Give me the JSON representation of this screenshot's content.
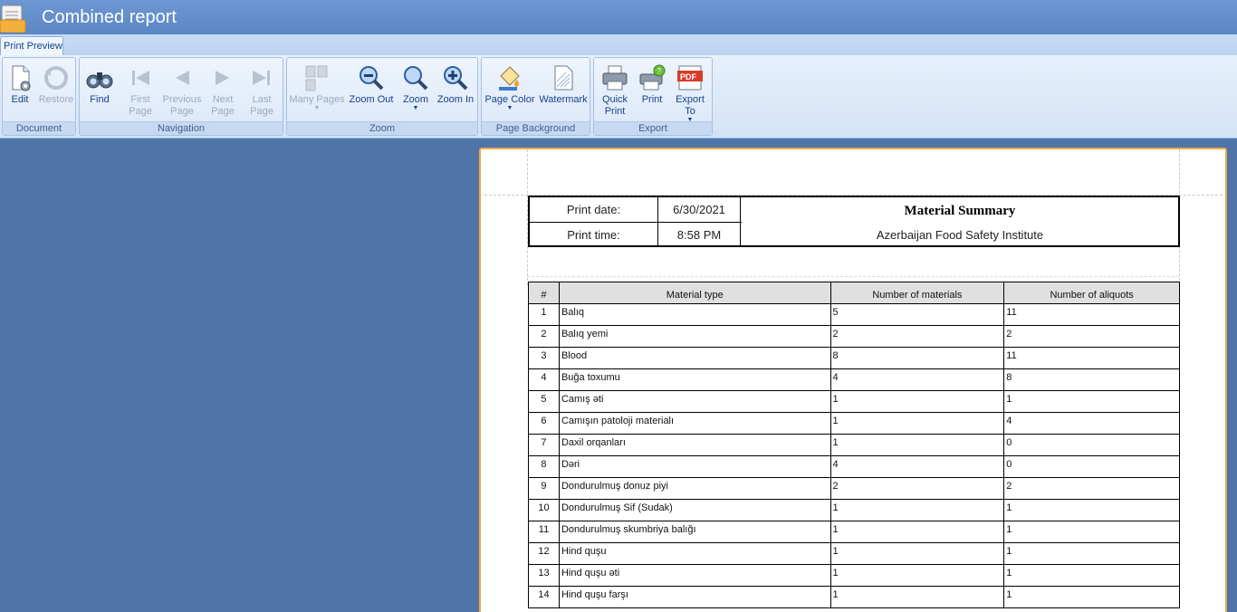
{
  "window": {
    "title": "Combined report"
  },
  "tabs": [
    {
      "label": "Print Preview"
    }
  ],
  "ribbon": {
    "groups": [
      {
        "label": "Document",
        "buttons": [
          {
            "label": "Edit",
            "enabled": true
          },
          {
            "label": "Restore",
            "enabled": false
          }
        ]
      },
      {
        "label": "Navigation",
        "buttons": [
          {
            "label": "Find",
            "enabled": true
          },
          {
            "label": "First Page",
            "enabled": false
          },
          {
            "label": "Previous Page",
            "enabled": false
          },
          {
            "label": "Next Page",
            "enabled": false
          },
          {
            "label": "Last Page",
            "enabled": false
          }
        ]
      },
      {
        "label": "Zoom",
        "buttons": [
          {
            "label": "Many Pages",
            "enabled": false
          },
          {
            "label": "Zoom Out",
            "enabled": true
          },
          {
            "label": "Zoom",
            "enabled": true
          },
          {
            "label": "Zoom In",
            "enabled": true
          }
        ]
      },
      {
        "label": "Page Background",
        "buttons": [
          {
            "label": "Page Color",
            "enabled": true
          },
          {
            "label": "Watermark",
            "enabled": true
          }
        ]
      },
      {
        "label": "Export",
        "buttons": [
          {
            "label": "Quick Print",
            "enabled": true
          },
          {
            "label": "Print",
            "enabled": true
          },
          {
            "label": "Export To",
            "enabled": true
          }
        ]
      }
    ]
  },
  "report": {
    "print_date_label": "Print date:",
    "print_date": "6/30/2021",
    "print_time_label": "Print time:",
    "print_time": "8:58 PM",
    "title": "Material Summary",
    "organization": "Azerbaijan Food Safety Institute",
    "columns": [
      "#",
      "Material type",
      "Number of materials",
      "Number of aliquots"
    ],
    "rows": [
      [
        "1",
        "Balıq",
        "5",
        "11"
      ],
      [
        "2",
        "Balıq yemi",
        "2",
        "2"
      ],
      [
        "3",
        "Blood",
        "8",
        "11"
      ],
      [
        "4",
        "Buğa toxumu",
        "4",
        "8"
      ],
      [
        "5",
        "Camış əti",
        "1",
        "1"
      ],
      [
        "6",
        "Camışın patoloji materialı",
        "1",
        "4"
      ],
      [
        "7",
        "Daxil orqanları",
        "1",
        "0"
      ],
      [
        "8",
        "Dəri",
        "4",
        "0"
      ],
      [
        "9",
        "Dondurulmuş donuz piyi",
        "2",
        "2"
      ],
      [
        "10",
        "Dondurulmuş Sif (Sudak)",
        "1",
        "1"
      ],
      [
        "11",
        "Dondurulmuş skumbriya balığı",
        "1",
        "1"
      ],
      [
        "12",
        "Hind quşu",
        "1",
        "1"
      ],
      [
        "13",
        "Hind quşu əti",
        "1",
        "1"
      ],
      [
        "14",
        "Hind quşu farşı",
        "1",
        "1"
      ]
    ]
  }
}
